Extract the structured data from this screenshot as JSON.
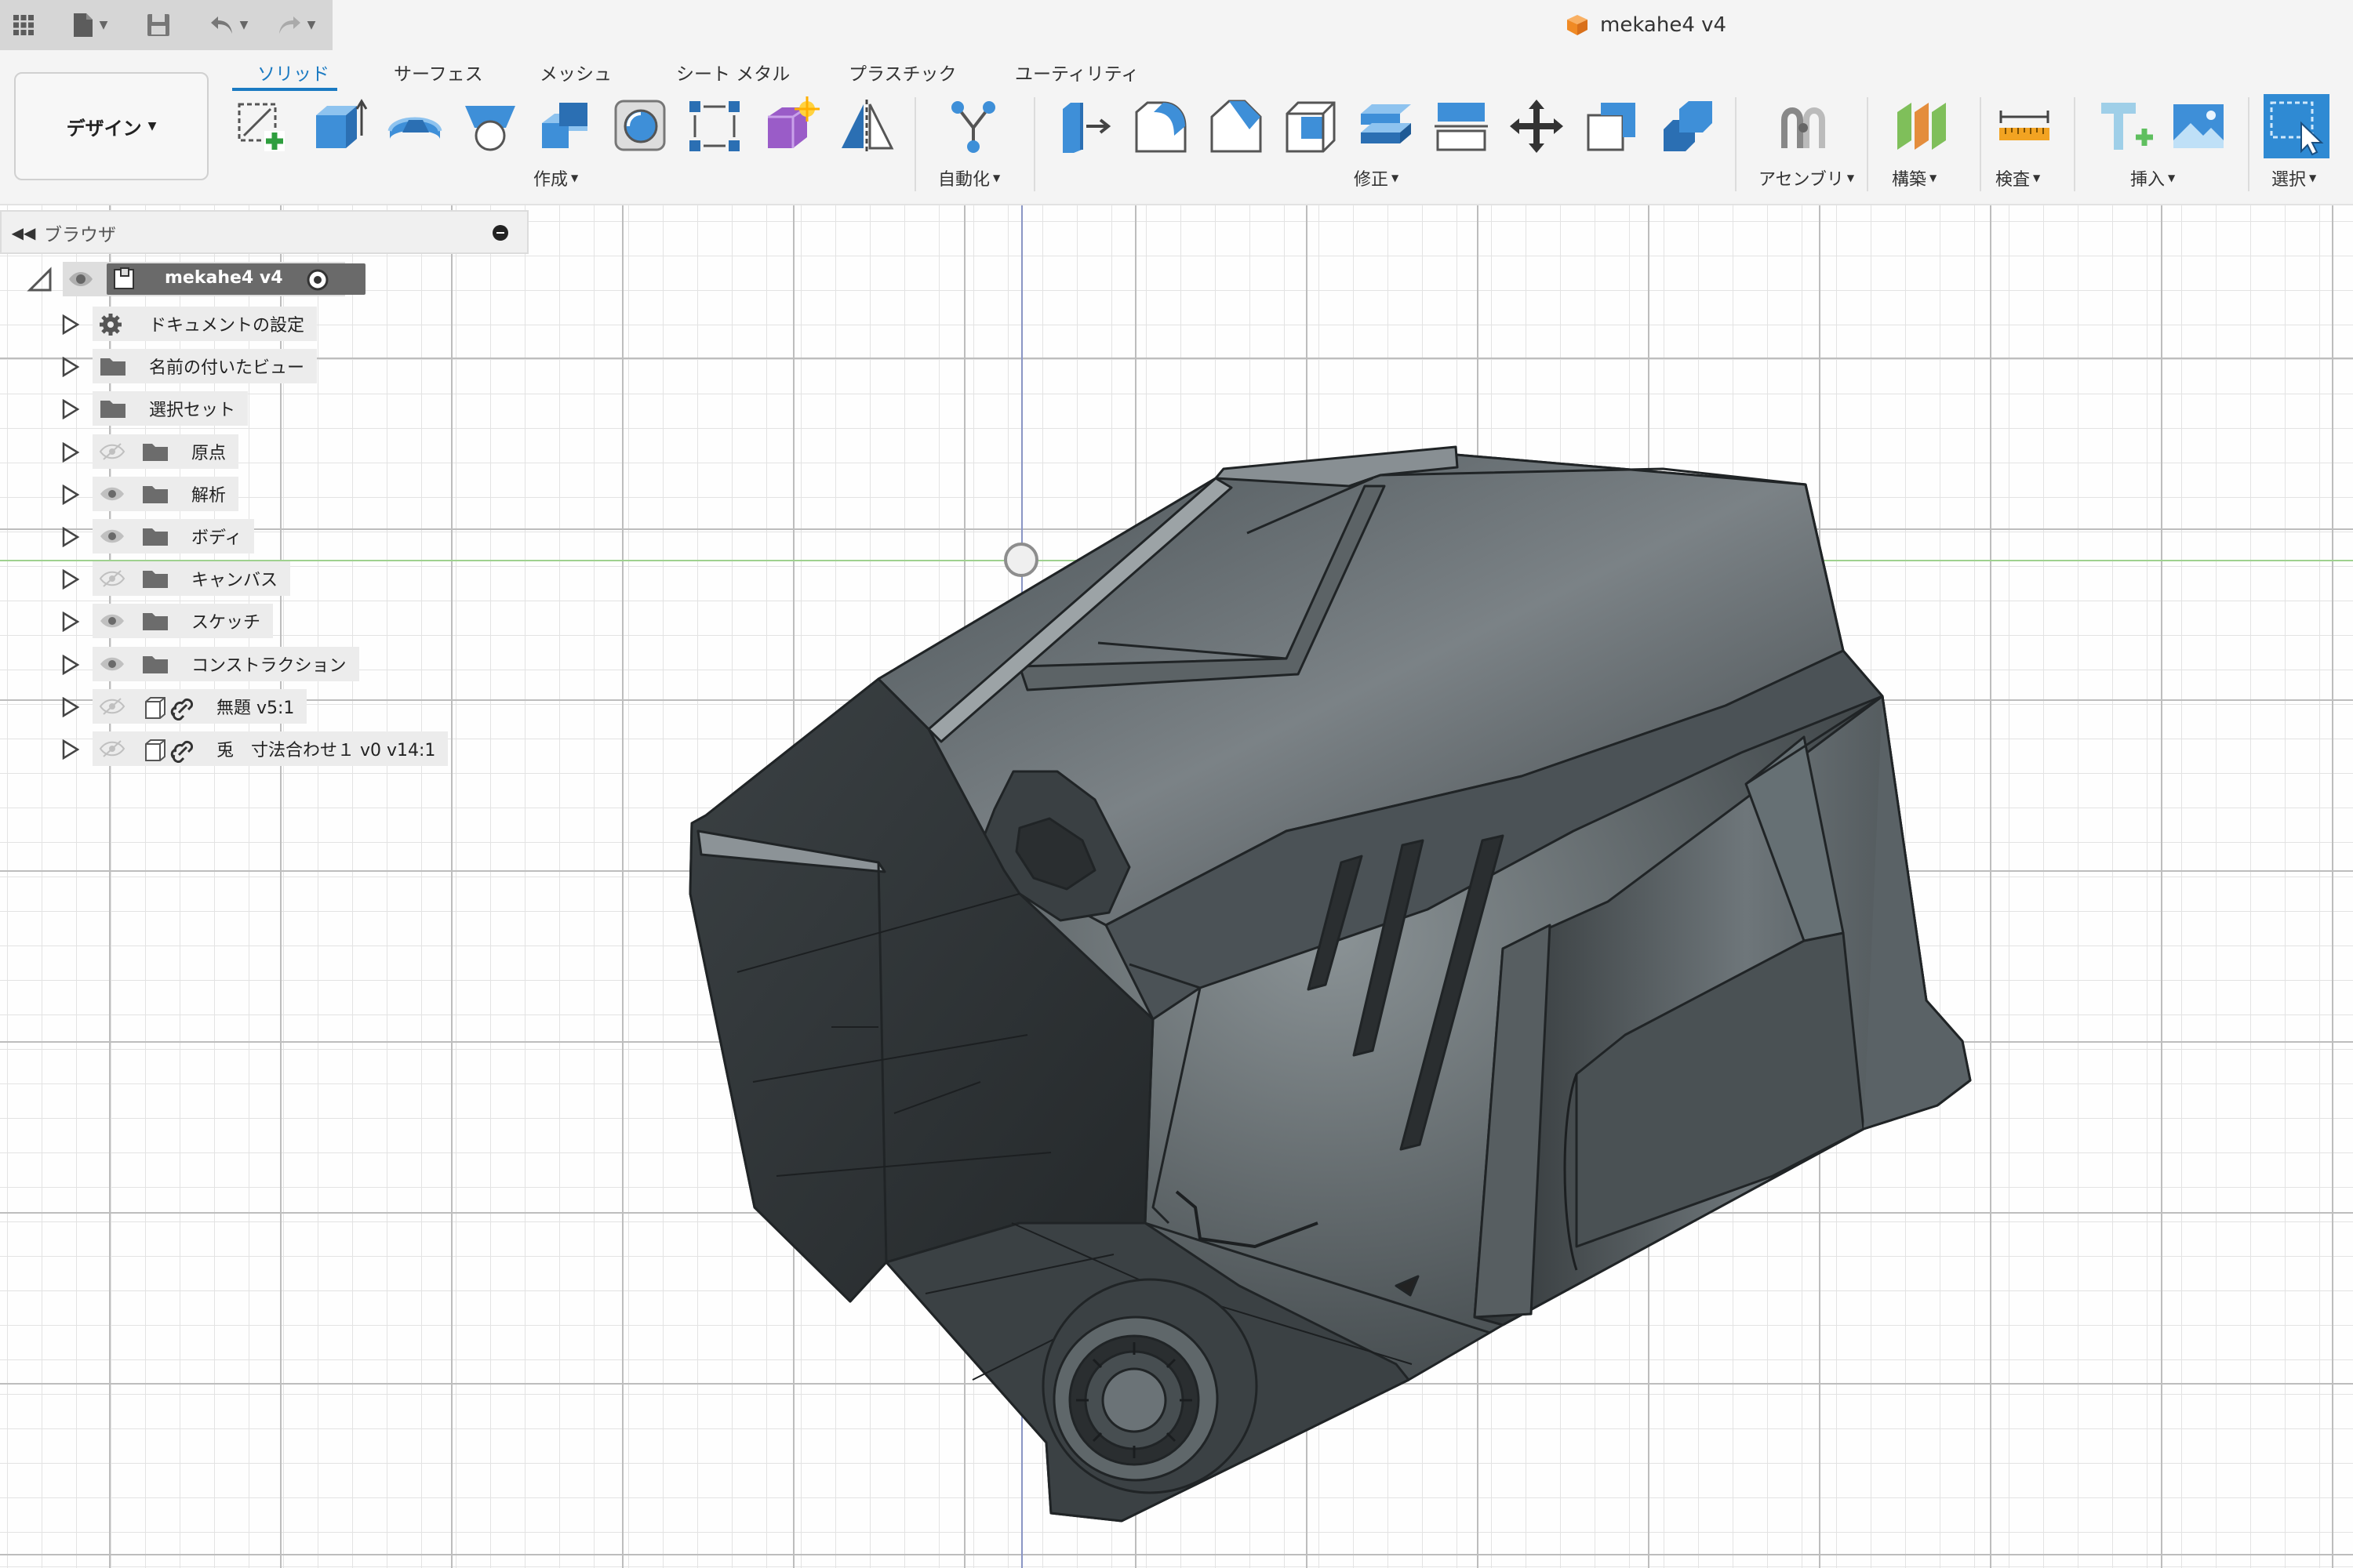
{
  "quick_access": {
    "grid_icon": "app-grid-icon",
    "file_icon": "file-icon",
    "save_icon": "save-icon",
    "undo_icon": "undo-icon",
    "redo_icon": "redo-icon"
  },
  "document": {
    "title": "mekahe4 v4",
    "icon": "cube-icon",
    "icon_color": "#f08a24"
  },
  "workspace": {
    "label": "デザイン"
  },
  "tabs": [
    {
      "label": "ソリッド",
      "active": true
    },
    {
      "label": "サーフェス",
      "active": false
    },
    {
      "label": "メッシュ",
      "active": false
    },
    {
      "label": "シート メタル",
      "active": false
    },
    {
      "label": "プラスチック",
      "active": false
    },
    {
      "label": "ユーティリティ",
      "active": false
    }
  ],
  "groups": {
    "create": "作成",
    "automate": "自動化",
    "modify": "修正",
    "assemble": "アセンブリ",
    "construct": "構築",
    "inspect": "検査",
    "insert": "挿入",
    "select": "選択"
  },
  "colors": {
    "accent": "#1a7ac2",
    "tool_blue": "#3e8fd8",
    "model_dark": "#3d4346",
    "green_axis": "#9fd18f",
    "blue_axis": "#8a95c4"
  },
  "browser": {
    "title": "ブラウザ",
    "root": {
      "label": "mekahe4 v4"
    },
    "items": [
      {
        "label": "ドキュメントの設定",
        "icon": "gear-icon",
        "visible": null
      },
      {
        "label": "名前の付いたビュー",
        "icon": "folder-icon",
        "visible": null
      },
      {
        "label": "選択セット",
        "icon": "folder-icon",
        "visible": null
      },
      {
        "label": "原点",
        "icon": "folder-icon",
        "visible": false
      },
      {
        "label": "解析",
        "icon": "folder-icon",
        "visible": true
      },
      {
        "label": "ボディ",
        "icon": "folder-icon",
        "visible": true
      },
      {
        "label": "キャンバス",
        "icon": "folder-icon",
        "visible": false
      },
      {
        "label": "スケッチ",
        "icon": "folder-icon",
        "visible": true
      },
      {
        "label": "コンストラクション",
        "icon": "folder-icon",
        "visible": true
      },
      {
        "label": "無題 v5:1",
        "icon": "component-link-icon",
        "visible": false
      },
      {
        "label": "兎　寸法合わせ１ v0 v14:1",
        "icon": "component-link-icon",
        "visible": false
      }
    ]
  }
}
